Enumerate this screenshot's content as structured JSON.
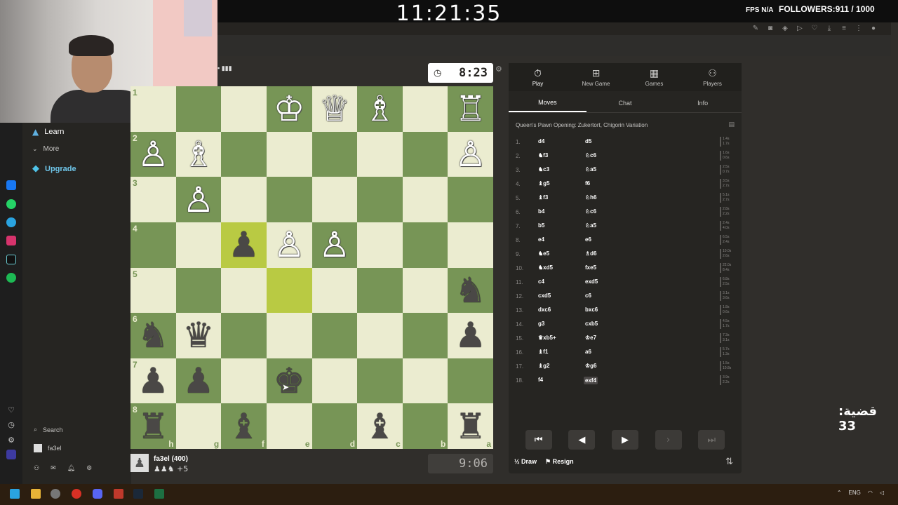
{
  "overlay": {
    "clock": "11:21:35",
    "fps_label": "FPS N/A",
    "followers": "FOLLOWERS:911 / 1000",
    "case_counter": "قضية: 33"
  },
  "sidebar": {
    "items": [
      {
        "label": "Learn",
        "icon": "graduation-cap-icon"
      },
      {
        "label": "More",
        "icon": "chevron-down-icon"
      },
      {
        "label": "Upgrade",
        "icon": "diamond-icon"
      }
    ],
    "search_label": "Search",
    "username": "fa3el"
  },
  "opponent": {
    "clock": "8:23"
  },
  "player": {
    "name": "fa3el (400)",
    "captured": "♟♟♞ +5",
    "clock": "9:06"
  },
  "board": {
    "ranks": [
      "1",
      "2",
      "3",
      "4",
      "5",
      "6",
      "7",
      "8"
    ],
    "files": [
      "h",
      "g",
      "f",
      "e",
      "d",
      "c",
      "b",
      "a"
    ],
    "rows": [
      [
        "",
        "",
        "",
        "wK",
        "wQ",
        "wB",
        "",
        "wR"
      ],
      [
        "wP",
        "wB",
        "",
        "",
        "",
        "",
        "",
        "wP"
      ],
      [
        "",
        "wP",
        "",
        "",
        "",
        "",
        "",
        ""
      ],
      [
        "",
        "",
        "bP",
        "wP",
        "wP",
        "",
        "",
        ""
      ],
      [
        "",
        "",
        "",
        "",
        "",
        "",
        "",
        "bN"
      ],
      [
        "bN",
        "bQ",
        "",
        "",
        "",
        "",
        "",
        "bP"
      ],
      [
        "bP",
        "bP",
        "",
        "bK",
        "",
        "",
        "",
        ""
      ],
      [
        "bR",
        "",
        "bB",
        "",
        "",
        "bB",
        "",
        "bR"
      ]
    ],
    "highlights": [
      "r3c2",
      "r4c3"
    ]
  },
  "panel": {
    "tabs": [
      {
        "label": "Play",
        "icon": "stopwatch-icon"
      },
      {
        "label": "New Game",
        "icon": "plus-icon"
      },
      {
        "label": "Games",
        "icon": "board-icon"
      },
      {
        "label": "Players",
        "icon": "players-icon"
      }
    ],
    "subtabs": [
      "Moves",
      "Chat",
      "Info"
    ],
    "opening": "Queen's Pawn Opening: Zukertort, Chigorin Variation",
    "moves": [
      {
        "n": "1.",
        "w": "d4",
        "b": "d5",
        "tw": "1.4s",
        "tb": "1.7s"
      },
      {
        "n": "2.",
        "w": "♞f3",
        "b": "♘c6",
        "tw": "1.6s",
        "tb": "0.6s"
      },
      {
        "n": "3.",
        "w": "♞c3",
        "b": "♘a5",
        "tw": "2.5s",
        "tb": "0.7s"
      },
      {
        "n": "4.",
        "w": "♝g5",
        "b": "f6",
        "tw": "3.5s",
        "tb": "2.7s"
      },
      {
        "n": "5.",
        "w": "♝f3",
        "b": "♘h6",
        "tw": "5.1s",
        "tb": "2.7s"
      },
      {
        "n": "6.",
        "w": "b4",
        "b": "♘c6",
        "tw": "2.8s",
        "tb": "2.2s"
      },
      {
        "n": "7.",
        "w": "b5",
        "b": "♘a5",
        "tw": "2.4s",
        "tb": "4.0s"
      },
      {
        "n": "8.",
        "w": "e4",
        "b": "e6",
        "tw": "6.5s",
        "tb": "2.4s"
      },
      {
        "n": "9.",
        "w": "♞e5",
        "b": "♗d6",
        "tw": "10.0s",
        "tb": "2.6s"
      },
      {
        "n": "10.",
        "w": "♞xd5",
        "b": "fxe5",
        "tw": "22.0s",
        "tb": "8.4s"
      },
      {
        "n": "11.",
        "w": "c4",
        "b": "exd5",
        "tw": "6.8s",
        "tb": "2.5s"
      },
      {
        "n": "12.",
        "w": "cxd5",
        "b": "c6",
        "tw": "3.1s",
        "tb": "3.6s"
      },
      {
        "n": "13.",
        "w": "dxc6",
        "b": "bxc6",
        "tw": "1.8s",
        "tb": "0.6s"
      },
      {
        "n": "14.",
        "w": "g3",
        "b": "cxb5",
        "tw": "4.5s",
        "tb": "1.7s"
      },
      {
        "n": "15.",
        "w": "♛xb5+",
        "b": "♔e7",
        "tw": "7.3s",
        "tb": "3.1s"
      },
      {
        "n": "16.",
        "w": "♝f1",
        "b": "a6",
        "tw": "5.7s",
        "tb": "1.3s"
      },
      {
        "n": "17.",
        "w": "♝g2",
        "b": "♔g6",
        "tw": "1.5s",
        "tb": "10.8s"
      },
      {
        "n": "18.",
        "w": "f4",
        "b": "exf4",
        "tw": "3.9s",
        "tb": "2.2s"
      }
    ],
    "draw_label": "Draw",
    "resign_label": "Resign"
  },
  "colors": {
    "light_square": "#ebecd0",
    "dark_square": "#779556",
    "highlight": "#b9ca43",
    "panel_bg": "#262522",
    "page_bg": "#302e2b"
  }
}
